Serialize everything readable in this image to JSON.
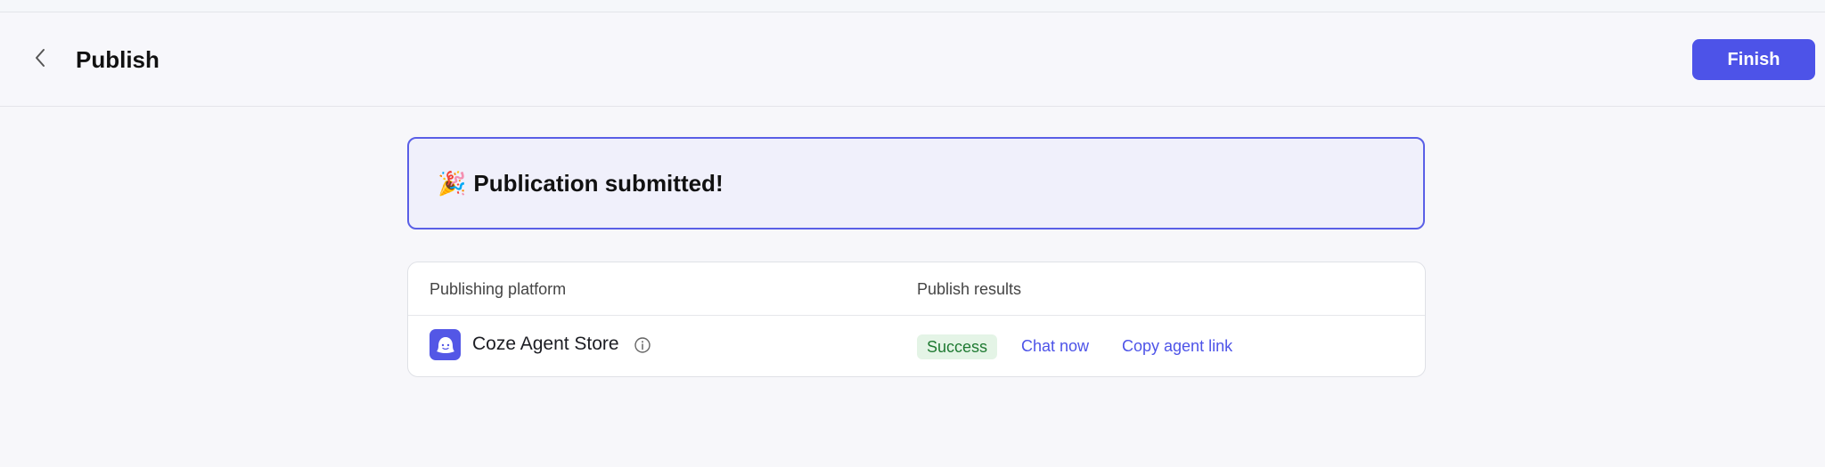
{
  "header": {
    "title": "Publish",
    "finish_label": "Finish",
    "back_icon": "chevron-left-icon"
  },
  "banner": {
    "icon": "🎉",
    "text": "Publication submitted!"
  },
  "table": {
    "columns": [
      "Publishing platform",
      "Publish results"
    ],
    "rows": [
      {
        "platform": "Coze Agent Store",
        "status": "Success",
        "actions": [
          "Chat now",
          "Copy agent link"
        ]
      }
    ]
  },
  "colors": {
    "accent": "#4d53e8",
    "success_bg": "#e4f4e6",
    "success_text": "#1f7a32"
  }
}
